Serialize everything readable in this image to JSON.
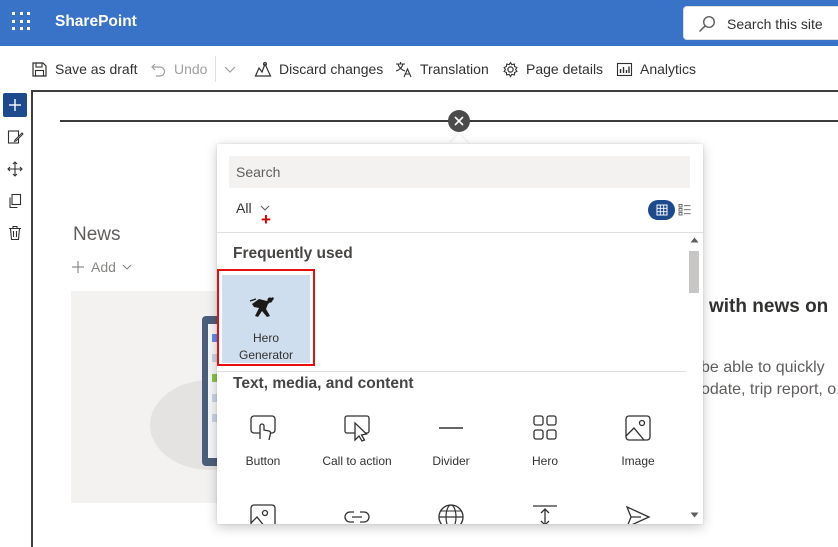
{
  "app": {
    "name": "SharePoint"
  },
  "search": {
    "placeholder": "Search this site"
  },
  "command_bar": {
    "save_draft": "Save as draft",
    "undo": "Undo",
    "discard": "Discard changes",
    "translation": "Translation",
    "page_details": "Page details",
    "analytics": "Analytics"
  },
  "news": {
    "title": "News",
    "add_label": "Add"
  },
  "placeholder": {
    "heading": "with news on",
    "line1": "be able to quickly",
    "line2": "odate, trip report, o."
  },
  "toolbox": {
    "search_placeholder": "Search",
    "filter": "All",
    "groups": [
      {
        "title": "Frequently used",
        "items": [
          {
            "label_line1": "Hero",
            "label_line2": "Generator",
            "icon": "hero-generator-icon"
          }
        ]
      },
      {
        "title": "Text, media, and content",
        "items": [
          {
            "label": "Button",
            "icon": "touch-icon"
          },
          {
            "label": "Call to action",
            "icon": "cursor-icon"
          },
          {
            "label": "Divider",
            "icon": "divider-icon"
          },
          {
            "label": "Hero",
            "icon": "tiles-icon"
          },
          {
            "label": "Image",
            "icon": "image-icon"
          }
        ]
      }
    ]
  },
  "colors": {
    "suite_bar": "#3973c8",
    "accent": "#1d4a8c",
    "highlight_outline": "#e60f0f",
    "selected_tile": "#cfdeee"
  }
}
